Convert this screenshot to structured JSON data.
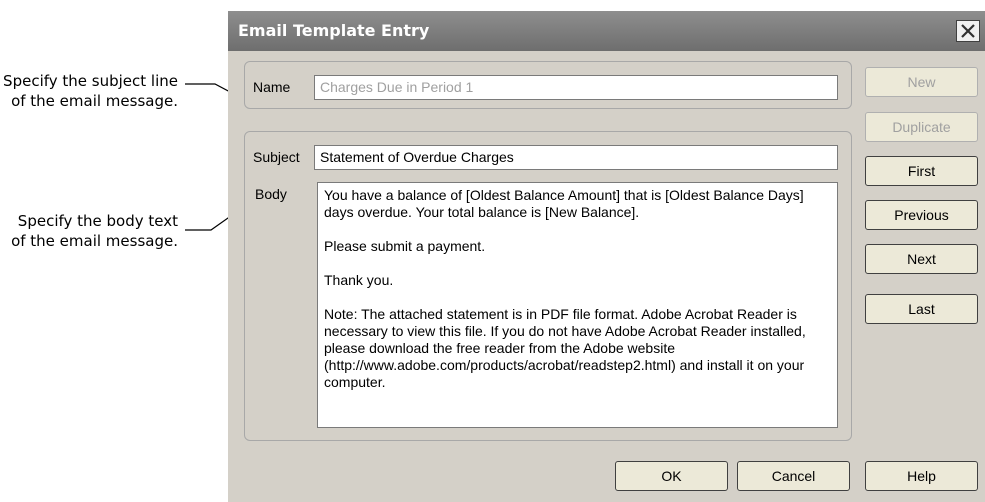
{
  "callouts": {
    "subject": "Specify the subject line of the email message.",
    "body": "Specify the body text of the email message."
  },
  "dialog": {
    "title": "Email Template Entry",
    "name_label": "Name",
    "name_value": "Charges Due in Period 1",
    "subject_label": "Subject",
    "subject_value": "Statement of Overdue Charges",
    "body_label": "Body",
    "body_paragraphs": [
      "You have a balance of [Oldest Balance Amount] that is [Oldest Balance Days] days overdue. Your total balance is [New Balance].",
      "Please submit a payment.",
      "Thank you.",
      "Note: The attached statement is in PDF file format.  Adobe Acrobat Reader is necessary to view this file.  If you do not have Adobe Acrobat Reader installed, please download the free reader from the Adobe website (http://www.adobe.com/products/acrobat/readstep2.html) and install it on your computer."
    ]
  },
  "buttons": {
    "new": "New",
    "duplicate": "Duplicate",
    "first": "First",
    "previous": "Previous",
    "next": "Next",
    "last": "Last",
    "ok": "OK",
    "cancel": "Cancel",
    "help": "Help"
  }
}
